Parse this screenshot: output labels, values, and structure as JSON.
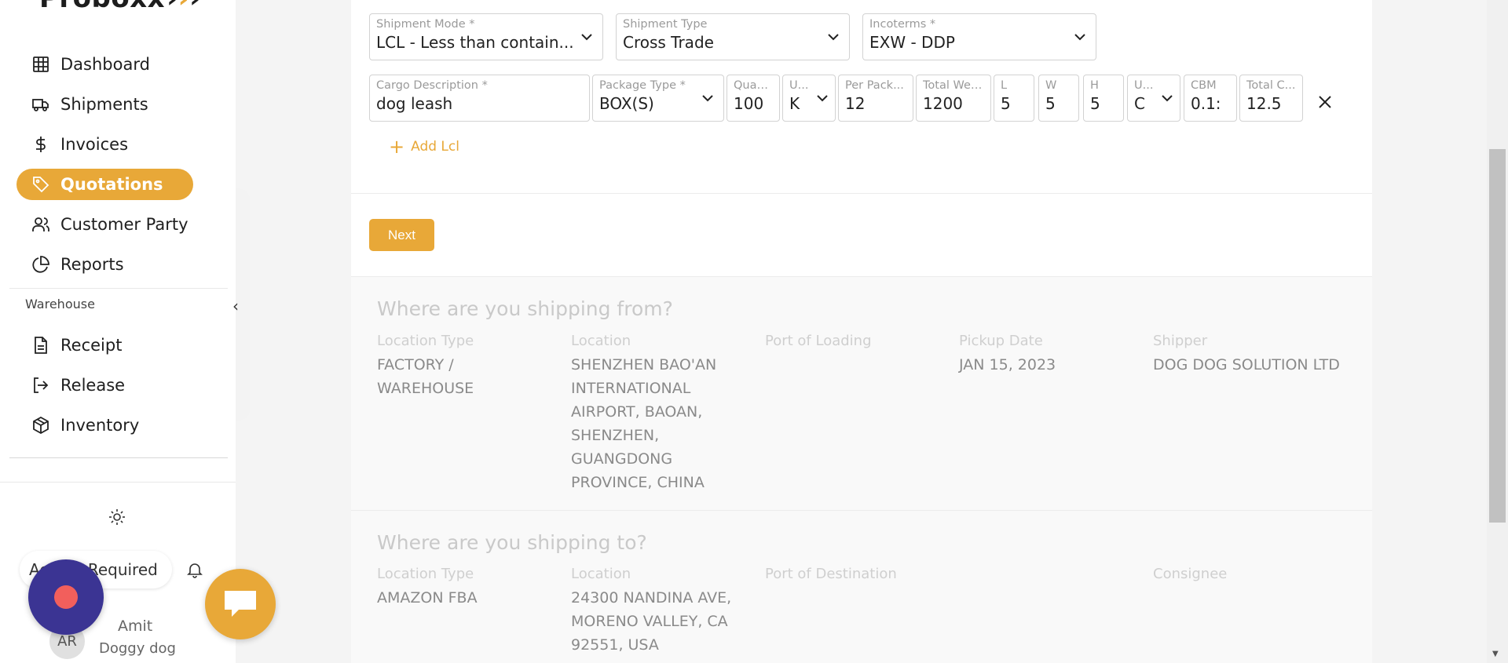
{
  "brand": {
    "name": "Proboxx"
  },
  "sidebar": {
    "items": [
      {
        "label": "Dashboard",
        "icon": "table-icon",
        "active": false
      },
      {
        "label": "Shipments",
        "icon": "truck-icon",
        "active": false
      },
      {
        "label": "Invoices",
        "icon": "dollar-icon",
        "active": false
      },
      {
        "label": "Quotations",
        "icon": "tag-icon",
        "active": true
      },
      {
        "label": "Customer Party",
        "icon": "users-icon",
        "active": false
      },
      {
        "label": "Reports",
        "icon": "pie-chart-icon",
        "active": false
      }
    ],
    "section_label": "Warehouse",
    "warehouse_items": [
      {
        "label": "Receipt",
        "icon": "file-icon"
      },
      {
        "label": "Release",
        "icon": "log-out-icon"
      },
      {
        "label": "Inventory",
        "icon": "box-icon"
      }
    ],
    "access_label": "Access Required",
    "user": {
      "initials": "AR",
      "name": "Amit",
      "company": "Doggy dog"
    },
    "accent_color": "#e8a838"
  },
  "form": {
    "shipment_mode": {
      "label": "Shipment Mode *",
      "value": "LCL - Less than contain..."
    },
    "shipment_type": {
      "label": "Shipment Type",
      "value": "Cross Trade"
    },
    "incoterms": {
      "label": "Incoterms *",
      "value": "EXW - DDP"
    },
    "cargo_row": {
      "cargo_description": {
        "label": "Cargo Description *",
        "value": "dog leash"
      },
      "package_type": {
        "label": "Package Type *",
        "value": "BOX(S)"
      },
      "quantity": {
        "label": "Quan...",
        "value": "100"
      },
      "weight_unit": {
        "label": "U...",
        "value": "K"
      },
      "per_package": {
        "label": "Per Pack...",
        "value": "12"
      },
      "total_weight": {
        "label": "Total Wei...",
        "value": "1200"
      },
      "length": {
        "label": "L",
        "value": "5"
      },
      "width": {
        "label": "W",
        "value": "5"
      },
      "height": {
        "label": "H",
        "value": "5"
      },
      "dimension_unit": {
        "label": "U...",
        "value": "C"
      },
      "cbm": {
        "label": "CBM",
        "value": "0.1:"
      },
      "total_cbm": {
        "label": "Total C...",
        "value": "12.5"
      }
    },
    "add_lcl_label": "Add Lcl",
    "next_label": "Next"
  },
  "origin": {
    "title": "Where are you shipping from?",
    "columns": [
      {
        "label": "Location Type",
        "value": "FACTORY / WAREHOUSE"
      },
      {
        "label": "Location",
        "value": "SHENZHEN BAO'AN INTERNATIONAL AIRPORT, BAOAN, SHENZHEN, GUANGDONG PROVINCE, CHINA"
      },
      {
        "label": "Port of Loading",
        "value": ""
      },
      {
        "label": "Pickup Date",
        "value": "JAN 15, 2023"
      },
      {
        "label": "Shipper",
        "value": "DOG DOG SOLUTION LTD"
      }
    ]
  },
  "destination": {
    "title": "Where are you shipping to?",
    "columns": [
      {
        "label": "Location Type",
        "value": "AMAZON FBA"
      },
      {
        "label": "Location",
        "value": "24300 NANDINA AVE, MORENO VALLEY, CA 92551, USA"
      },
      {
        "label": "Port of Destination",
        "value": ""
      },
      {
        "label": "Consignee",
        "value": ""
      }
    ]
  }
}
